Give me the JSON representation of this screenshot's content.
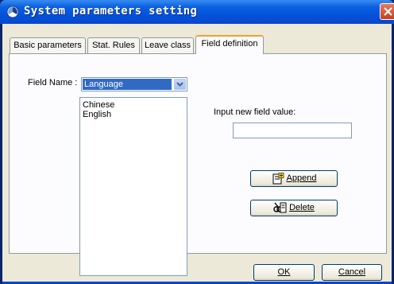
{
  "window": {
    "title": "System parameters setting",
    "close_symbol": "×"
  },
  "tabs": [
    {
      "label": "Basic parameters",
      "active": false
    },
    {
      "label": "Stat. Rules",
      "active": false
    },
    {
      "label": "Leave class",
      "active": false
    },
    {
      "label": "Field definition",
      "active": true
    }
  ],
  "field_definition": {
    "field_name_label": "Field Name :",
    "field_name_value": "Language",
    "values": [
      "Chinese",
      "English"
    ],
    "input_label": "Input new field value:",
    "input_value": "",
    "append_label": "Append",
    "append_mnemonic": "A",
    "delete_label": "Delete",
    "delete_mnemonic": "D"
  },
  "footer": {
    "ok_label": "OK",
    "ok_mnemonic": "O",
    "cancel_label": "Cancel",
    "cancel_mnemonic": "C"
  }
}
